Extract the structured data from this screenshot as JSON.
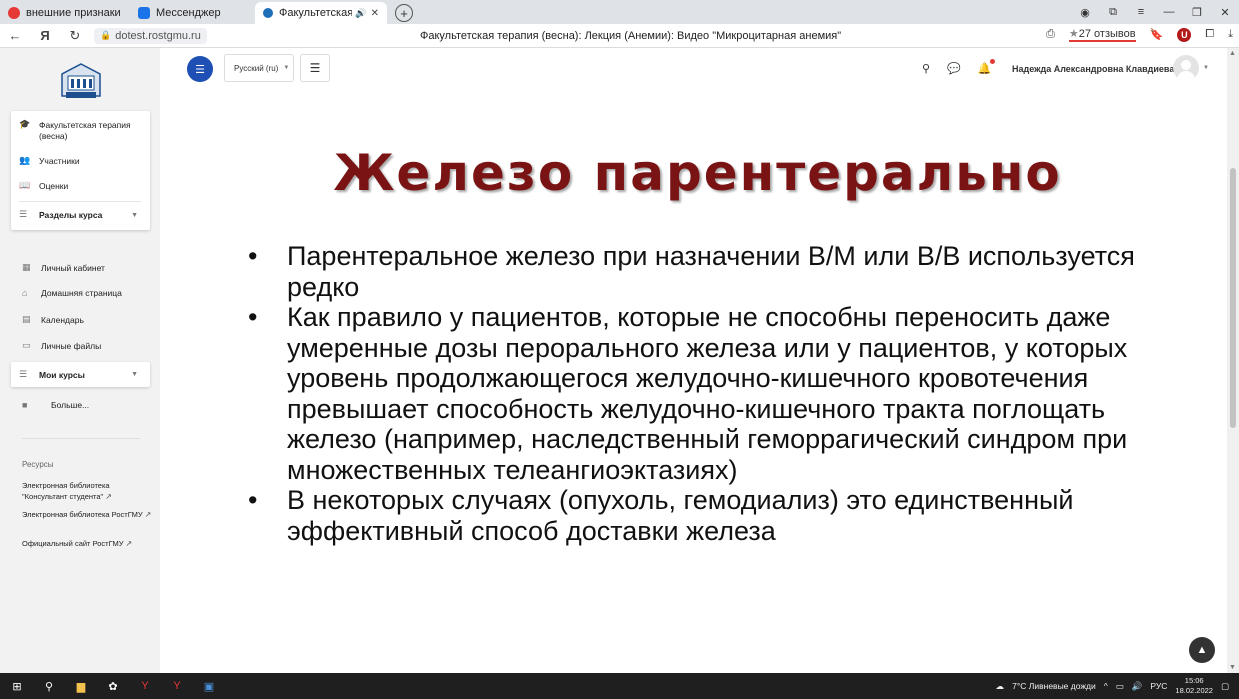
{
  "browser": {
    "tabs": [
      {
        "label": "внешние признаки хобл",
        "favicon_color": "#e53935"
      },
      {
        "label": "Мессенджер",
        "favicon_color": "#1a73e8"
      },
      {
        "label": "Факультетская терапи",
        "favicon_color": "#1d6fb8"
      }
    ],
    "tab_close": "✕",
    "new_tab": "+",
    "url": "dotest.rostgmu.ru",
    "page_title": "Факультетская терапия (весна): Лекция (Анемии): Видео \"Микроцитарная анемия\"",
    "reviews": "27 отзывов",
    "ext_badge": "U"
  },
  "sidebar": {
    "course_card": {
      "items": [
        {
          "label": "Факультетская терапия (весна)",
          "icon": "graduation-cap-icon"
        },
        {
          "label": "Участники",
          "icon": "users-icon"
        },
        {
          "label": "Оценки",
          "icon": "book-icon"
        }
      ],
      "sections_label": "Разделы курса"
    },
    "nav": [
      {
        "label": "Личный кабинет",
        "icon": "dashboard-icon"
      },
      {
        "label": "Домашняя страница",
        "icon": "home-icon"
      },
      {
        "label": "Календарь",
        "icon": "calendar-icon"
      },
      {
        "label": "Личные файлы",
        "icon": "file-icon"
      }
    ],
    "my_courses": "Мои курсы",
    "more": "Больше...",
    "resources_title": "Ресурсы",
    "resources": [
      {
        "label": "Электронная библиотека \"Консультант студента\""
      },
      {
        "label": "Электронная библиотека РостГМУ"
      },
      {
        "label": "Официальный сайт РостГМУ"
      }
    ]
  },
  "header": {
    "language": "Русский (ru)",
    "username": "Надежда Александровна Клавдиева"
  },
  "slide": {
    "title": "Железо парентерально",
    "bullet_char": "•",
    "bullets": [
      "Парентеральное железо при назначении В/М или В/В используется  редко",
      "Как правило у пациентов, которые не способны переносить даже умеренные дозы перорального железа или у пациентов, у которых уровень продолжающегося желудочно-кишечного кровотечения превышает способность желудочно-кишечного тракта поглощать железо (например, наследственный геморрагический синдром при множественных телеангиоэктазиях)",
      "В некоторых случаях (опухоль, гемодиализ) это единственный эффективный способ доставки железа"
    ]
  },
  "taskbar": {
    "weather": "7°C  Ливневые дожди",
    "lang": "РУС",
    "time": "15:06",
    "date": "18.02.2022"
  },
  "colors": {
    "accent": "#1d4fb4",
    "slide_title": "#7a1414"
  }
}
